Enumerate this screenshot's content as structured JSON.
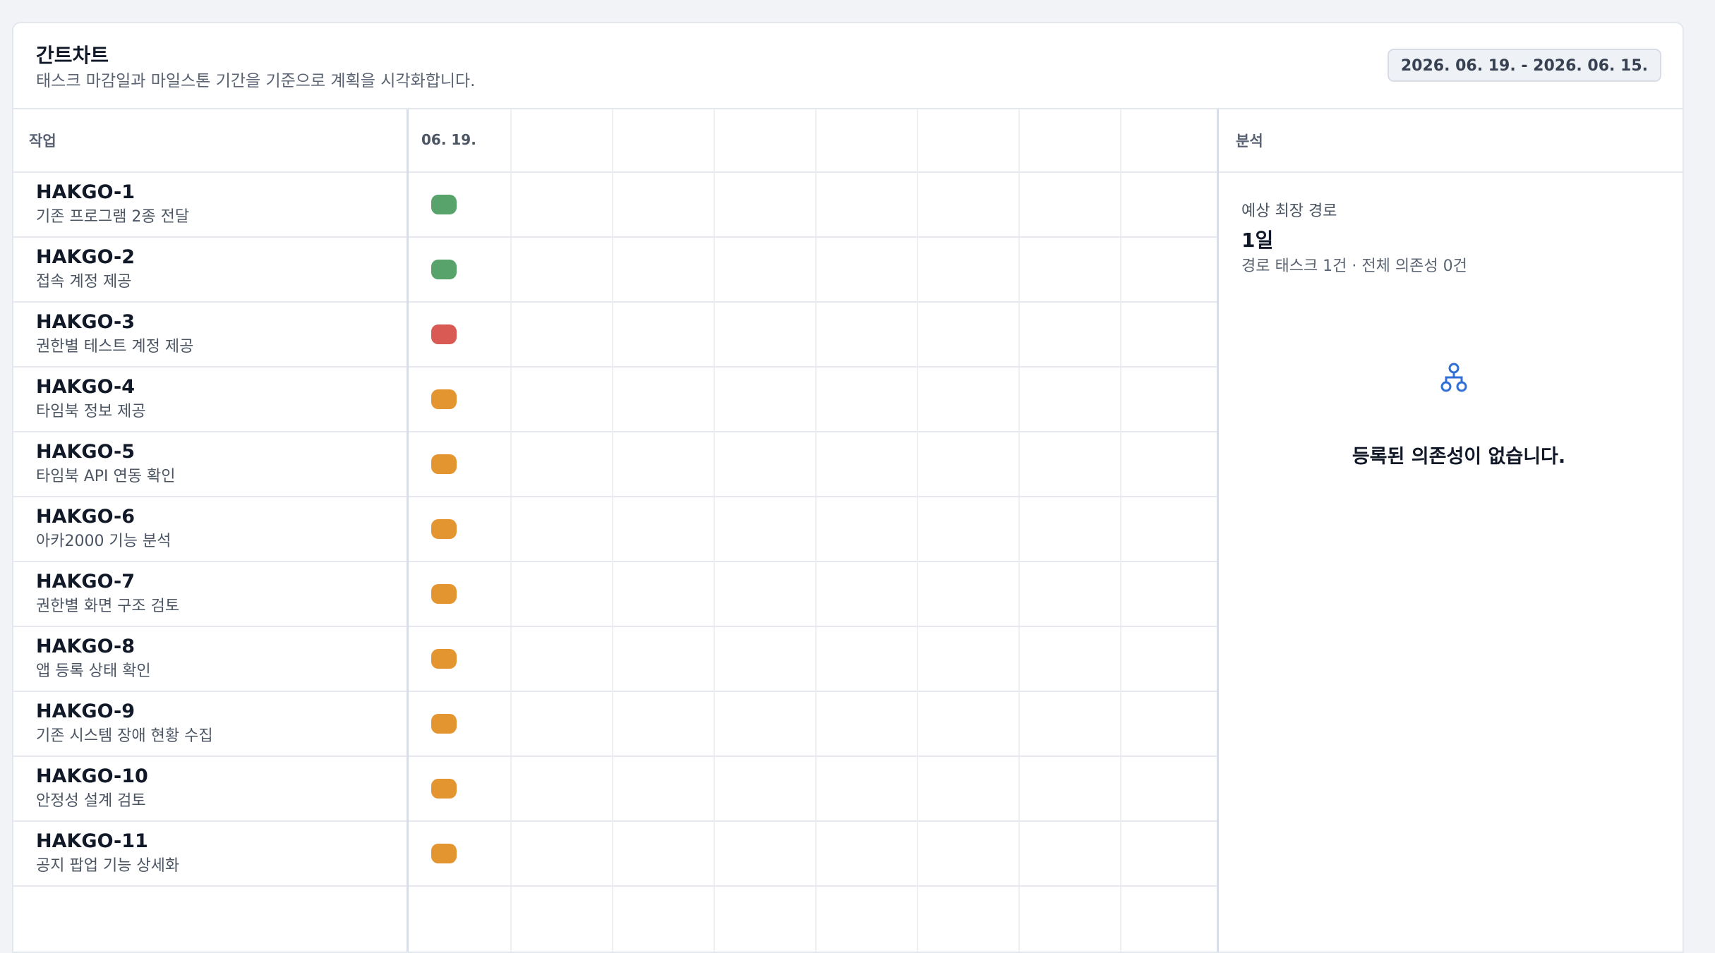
{
  "header": {
    "title": "간트차트",
    "subtitle": "태스크 마감일과 마일스톤 기간을 기준으로 계획을 시각화합니다.",
    "date_range": "2026. 06. 19. - 2026. 06. 15."
  },
  "task_column": {
    "header": "작업"
  },
  "timeline": {
    "first_date": "06. 19."
  },
  "colors": {
    "done": "#57a36b",
    "blocked": "#d95a54",
    "pending": "#e3962f"
  },
  "tasks": [
    {
      "id": "HAKGO-1",
      "name": "기존 프로그램 2종 전달",
      "status": "done"
    },
    {
      "id": "HAKGO-2",
      "name": "접속 계정 제공",
      "status": "done"
    },
    {
      "id": "HAKGO-3",
      "name": "권한별 테스트 계정 제공",
      "status": "blocked"
    },
    {
      "id": "HAKGO-4",
      "name": "타임북 정보 제공",
      "status": "pending"
    },
    {
      "id": "HAKGO-5",
      "name": "타임북 API 연동 확인",
      "status": "pending"
    },
    {
      "id": "HAKGO-6",
      "name": "아카2000 기능 분석",
      "status": "pending"
    },
    {
      "id": "HAKGO-7",
      "name": "권한별 화면 구조 검토",
      "status": "pending"
    },
    {
      "id": "HAKGO-8",
      "name": "앱 등록 상태 확인",
      "status": "pending"
    },
    {
      "id": "HAKGO-9",
      "name": "기존 시스템 장애 현황 수집",
      "status": "pending"
    },
    {
      "id": "HAKGO-10",
      "name": "안정성 설계 검토",
      "status": "pending"
    },
    {
      "id": "HAKGO-11",
      "name": "공지 팝업 기능 상세화",
      "status": "pending"
    }
  ],
  "analysis": {
    "header": "분석",
    "critical_path_label": "예상 최장 경로",
    "critical_path_value": "1일",
    "critical_path_detail": "경로 태스크 1건 · 전체 의존성 0건",
    "empty_icon": "dependency-network-icon",
    "empty_message": "등록된 의존성이 없습니다."
  }
}
